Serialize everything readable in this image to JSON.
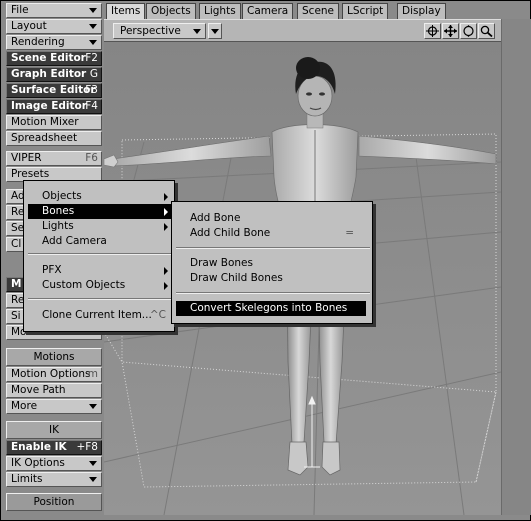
{
  "toolbar": {
    "file": "File",
    "layout": "Layout",
    "rendering": "Rendering",
    "scene_editor": "Scene Editor",
    "scene_editor_sc": "F2",
    "graph_editor": "Graph Editor",
    "graph_editor_sc": "G",
    "surface_editor": "Surface Editor",
    "surface_editor_sc": "F3",
    "image_editor": "Image Editor",
    "image_editor_sc": "F4",
    "motion_mixer": "Motion Mixer",
    "spreadsheet": "Spreadsheet",
    "viper": "VIPER",
    "viper_sc": "F6",
    "presets": "Presets",
    "partial_ad": "Ad",
    "partial_re": "Re",
    "partial_se": "Se",
    "partial_cl": "Cl",
    "partial_m": "M",
    "partial_re2": "Re",
    "partial_si": "Si",
    "more1": "More",
    "motions": "Motions",
    "motion_options": "Motion Options",
    "motion_options_sc": "m",
    "move_path": "Move Path",
    "more2": "More",
    "ik": "IK",
    "enable_ik": "Enable IK",
    "enable_ik_sc": "+F8",
    "ik_options": "IK Options",
    "limits": "Limits",
    "position": "Position"
  },
  "tabs": [
    "Items",
    "Objects",
    "Lights",
    "Camera",
    "Scene",
    "LScript",
    "Display"
  ],
  "viewport": {
    "view_mode": "Perspective"
  },
  "add_menu": {
    "objects": "Objects",
    "bones": "Bones",
    "lights": "Lights",
    "add_camera": "Add Camera",
    "pfx": "PFX",
    "custom_objects": "Custom Objects",
    "clone_current_item": "Clone Current Item...",
    "clone_sc": "^C"
  },
  "bones_menu": {
    "add_bone": "Add Bone",
    "add_child_bone": "Add Child Bone",
    "add_child_bone_sc": "=",
    "draw_bones": "Draw Bones",
    "draw_child_bones": "Draw Child Bones",
    "convert_skelegons": "Convert Skelegons into Bones"
  },
  "icons": [
    "move-icon",
    "move-view-icon",
    "rotate-view-icon",
    "zoom-icon"
  ],
  "colors": {
    "toolbar_button": "#c8c8c8",
    "active_button": "#3a3a3a",
    "viewport_bg": "#8e8e8e",
    "menu_bg": "#c0c0c0",
    "menu_selected": "#000000"
  }
}
